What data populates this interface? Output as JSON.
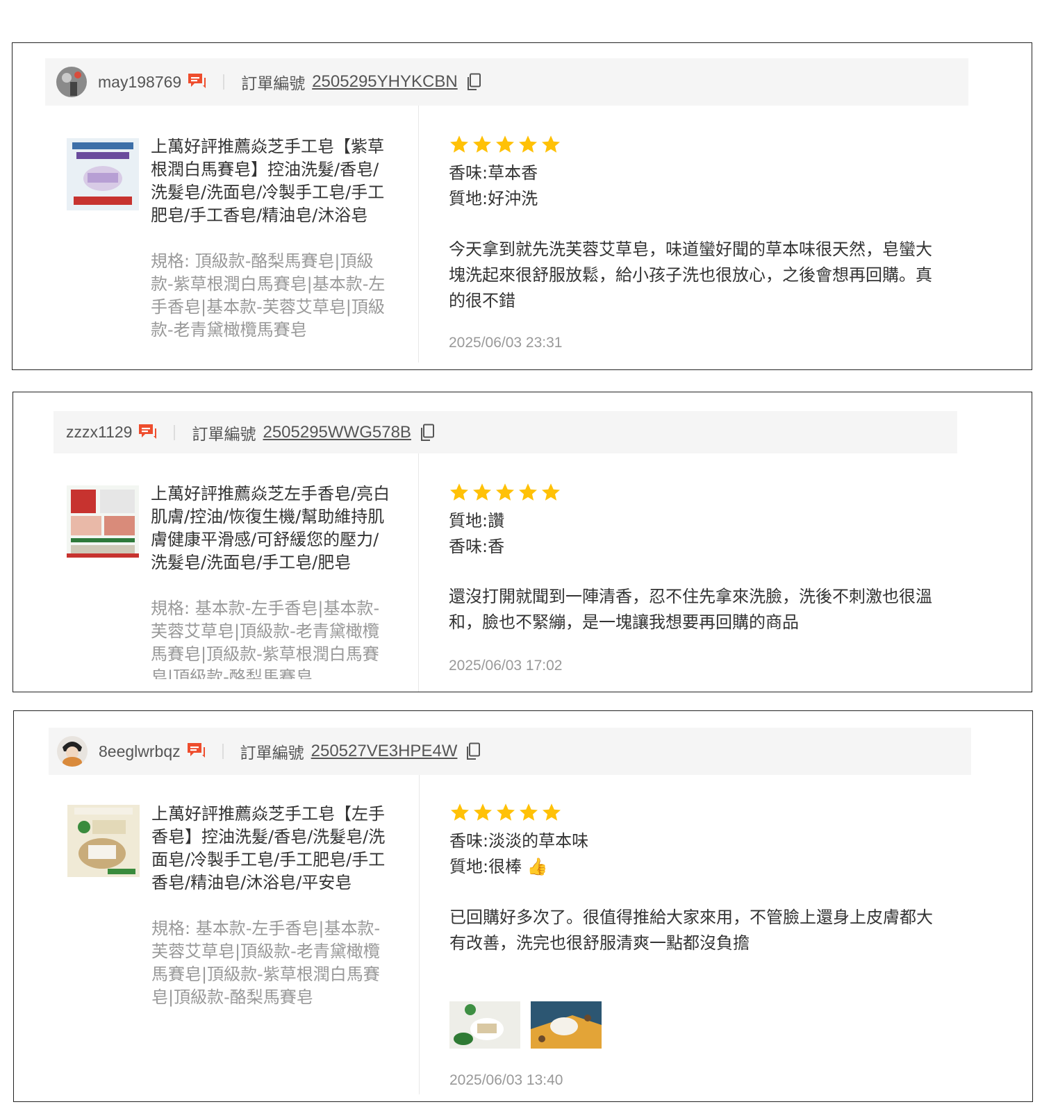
{
  "reviews": [
    {
      "username": "may198769",
      "order_label": "訂單編號",
      "order_number": "2505295YHYKCBN",
      "product_title": "上萬好評推薦焱芝手工皂【紫草根潤白馬賽皂】控油洗髮/香皂/洗髮皂/洗面皂/冷製手工皂/手工肥皂/手工香皂/精油皂/沐浴皂",
      "product_spec": "規格: 頂級款-酪梨馬賽皂|頂級款-紫草根潤白馬賽皂|基本款-左手香皂|基本款-芙蓉艾草皂|頂級款-老青黛橄欖馬賽皂",
      "rating": 5,
      "attr1": "香味:草本香",
      "attr2": "質地:好沖洗",
      "text": "今天拿到就先洗芙蓉艾草皂，味道蠻好聞的草本味很天然，皂蠻大塊洗起來很舒服放鬆，給小孩子洗也很放心，之後會想再回購。真的很不錯",
      "date": "2025/06/03 23:31"
    },
    {
      "username": "zzzx1129",
      "order_label": "訂單編號",
      "order_number": "2505295WWG578B",
      "product_title": "上萬好評推薦焱芝左手香皂/亮白肌膚/控油/恢復生機/幫助維持肌膚健康平滑感/可舒緩您的壓力/洗髮皂/洗面皂/手工皂/肥皂",
      "product_spec": "規格: 基本款-左手香皂|基本款-芙蓉艾草皂|頂級款-老青黛橄欖馬賽皂|頂級款-紫草根潤白馬賽皂|頂級款-酪梨馬賽皂",
      "rating": 5,
      "attr1": "質地:讚",
      "attr2": "香味:香",
      "text": "還沒打開就聞到一陣清香，忍不住先拿來洗臉，洗後不刺激也很溫和，臉也不緊繃，是一塊讓我想要再回購的商品",
      "date": "2025/06/03 17:02"
    },
    {
      "username": "8eeglwrbqz",
      "order_label": "訂單編號",
      "order_number": "250527VE3HPE4W",
      "product_title": "上萬好評推薦焱芝手工皂【左手香皂】控油洗髮/香皂/洗髮皂/洗面皂/冷製手工皂/手工肥皂/手工香皂/精油皂/沐浴皂/平安皂",
      "product_spec": "規格: 基本款-左手香皂|基本款-芙蓉艾草皂|頂級款-老青黛橄欖馬賽皂|頂級款-紫草根潤白馬賽皂|頂級款-酪梨馬賽皂",
      "rating": 5,
      "attr1": "香味:淡淡的草本味",
      "attr2": "質地:很棒 👍",
      "text": "已回購好多次了。很值得推給大家來用，不管臉上還身上皮膚都大有改善，洗完也很舒服清爽一點都沒負擔",
      "date": "2025/06/03 13:40"
    }
  ],
  "colors": {
    "accent": "#ee4d2d",
    "star": "#ffc107",
    "header_bg": "#f5f5f5"
  },
  "icons": {
    "chat": "chat-bubble-icon",
    "copy": "copy-icon",
    "star": "star-icon"
  }
}
